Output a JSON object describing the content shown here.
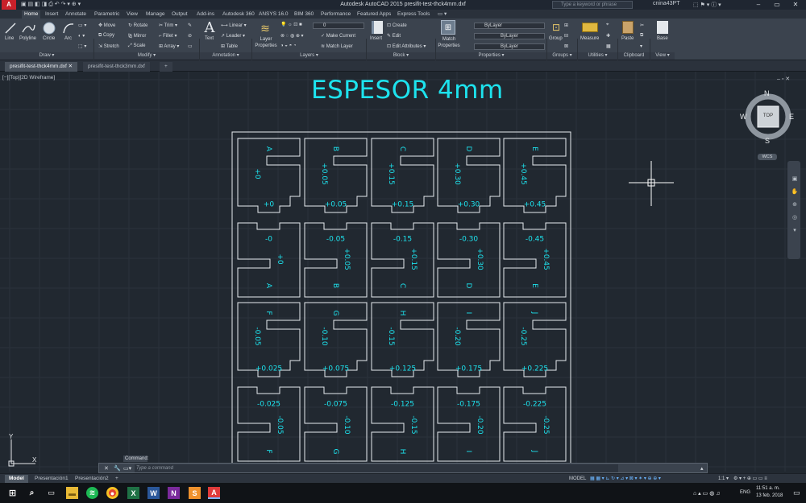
{
  "window": {
    "title": "Autodesk AutoCAD 2015    presifit-test-thck4mm.dxf",
    "search_placeholder": "Type a keyword or phrase",
    "user": "cnina43PT",
    "minimize": "–",
    "maximize": "▭",
    "close": "✕"
  },
  "ribbon_tabs": [
    "Home",
    "Insert",
    "Annotate",
    "Parametric",
    "View",
    "Manage",
    "Output",
    "Add-ins",
    "Autodesk 360",
    "ANSYS 16.0",
    "BIM 360",
    "Performance",
    "Featured Apps",
    "Express Tools"
  ],
  "draw": {
    "line": "Line",
    "polyline": "Polyline",
    "circle": "Circle",
    "arc": "Arc",
    "panel": "Draw ▾"
  },
  "modify": {
    "move": "Move",
    "rotate": "Rotate",
    "trim": "Trim ▾",
    "copy": "Copy",
    "mirror": "Mirror",
    "fillet": "Fillet ▾",
    "stretch": "Stretch",
    "scale": "Scale",
    "array": "Array ▾",
    "panel": "Modify ▾"
  },
  "annotation": {
    "text": "Text",
    "linear": "Linear ▾",
    "leader": "Leader ▾",
    "table": "Table",
    "panel": "Annotation ▾"
  },
  "layers": {
    "layer_properties": "Layer Properties",
    "layer_value": "0",
    "make_current": "Make Current",
    "match_layer": "Match Layer",
    "panel": "Layers ▾"
  },
  "block": {
    "insert": "Insert",
    "create": "Create",
    "edit": "Edit",
    "edit_attributes": "Edit Attributes ▾",
    "panel": "Block ▾"
  },
  "properties": {
    "match": "Match Properties",
    "bylayer1": "ByLayer",
    "bylayer2": "ByLayer",
    "bylayer3": "ByLayer",
    "panel": "Properties ▾"
  },
  "groups": {
    "group": "Group",
    "panel": "Groups ▾"
  },
  "utilities": {
    "measure": "Measure",
    "panel": "Utilities ▾"
  },
  "clipboard": {
    "paste": "Paste",
    "panel": "Clipboard"
  },
  "view_panel": {
    "base": "Base",
    "panel": "View ▾"
  },
  "file_tabs": [
    "presifit-test-thck4mm.dxf",
    "presifit-test-thck3mm.dxf"
  ],
  "viewport_label": "[−][Top][2D Wireframe]",
  "drawing": {
    "title": "ESPESOR 4mm",
    "row1_letters": [
      "A",
      "B",
      "C",
      "D",
      "E"
    ],
    "row1_side": [
      "+0",
      "+0.05",
      "+0.15",
      "+0.30",
      "+0.45"
    ],
    "row1_bottom": [
      "+0",
      "+0.05",
      "+0.15",
      "+0.30",
      "+0.45"
    ],
    "row2_top": [
      "-0",
      "-0.05",
      "-0.15",
      "-0.30",
      "-0.45"
    ],
    "row2_side": [
      "+0",
      "+0.05",
      "+0.15",
      "+0.30",
      "+0.45"
    ],
    "row2_letters": [
      "A",
      "B",
      "C",
      "D",
      "E"
    ],
    "row3_letters": [
      "F",
      "G",
      "H",
      "I",
      "J"
    ],
    "row3_side": [
      "-0.05",
      "-0.10",
      "-0.15",
      "-0.20",
      "-0.25"
    ],
    "row3_bottom": [
      "+0.025",
      "+0.075",
      "+0.125",
      "+0.175",
      "+0.225"
    ],
    "row4_top": [
      "-0.025",
      "-0.075",
      "-0.125",
      "-0.175",
      "-0.225"
    ],
    "row4_side": [
      "-0.05",
      "-0.10",
      "-0.15",
      "-0.20",
      "-0.25"
    ],
    "row4_letters": [
      "F",
      "G",
      "H",
      "I",
      "J"
    ]
  },
  "viewcube": {
    "n": "N",
    "s": "S",
    "e": "E",
    "w": "W",
    "top": "TOP",
    "wcs": "WCS"
  },
  "ucs": {
    "x": "X",
    "y": "Y"
  },
  "command": {
    "label": "Command:",
    "placeholder": "Type a command"
  },
  "layout_tabs": [
    "Model",
    "Presentación1",
    "Presentación2",
    "+"
  ],
  "status": {
    "model": "MODEL",
    "scale": "1:1 ▾"
  },
  "taskbar": {
    "time": "11:51 a. m.",
    "date": "13 feb. 2018",
    "lang": "ENG"
  },
  "colors": {
    "accent_cyan": "#1de3ee",
    "lines": "#e8ecf0",
    "background": "#212830"
  }
}
